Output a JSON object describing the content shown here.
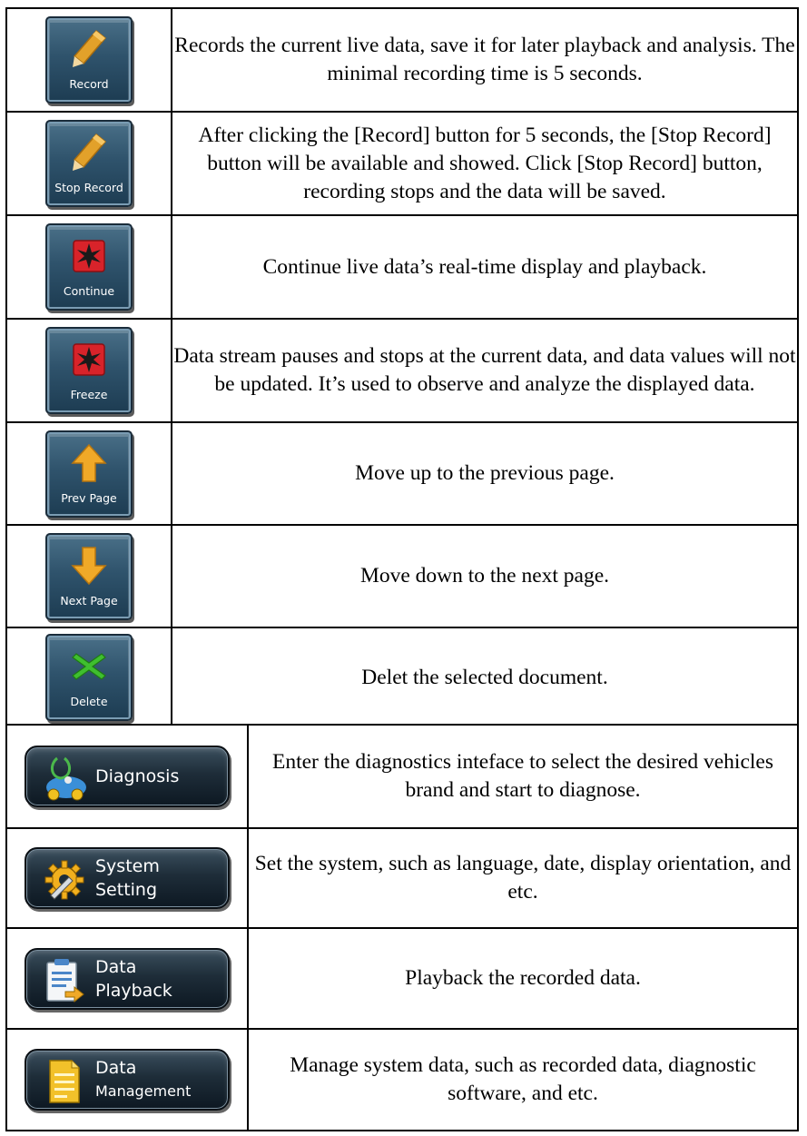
{
  "rows_small": [
    {
      "button_label": "Record",
      "icon": "pencil-icon",
      "description": "Records the current live data, save it for later playback and analysis. The minimal recording time is 5 seconds."
    },
    {
      "button_label": "Stop Record",
      "icon": "pencil-icon",
      "description": "After clicking the [Record] button for 5 seconds, the [Stop Record] button will be available and showed. Click [Stop Record] button, recording stops and the data will be saved."
    },
    {
      "button_label": "Continue",
      "icon": "red-star-icon",
      "description": "Continue live data’s real-time display and playback."
    },
    {
      "button_label": "Freeze",
      "icon": "red-star-icon",
      "description": "Data stream pauses and stops at the current data, and data values will not be updated. It’s used to observe and analyze the displayed data."
    },
    {
      "button_label": "Prev Page",
      "icon": "arrow-up-icon",
      "description": "Move up to the previous page."
    },
    {
      "button_label": "Next Page",
      "icon": "arrow-down-icon",
      "description": "Move down to the next page."
    },
    {
      "button_label": "Delete",
      "icon": "green-x-icon",
      "description": "Delet the selected document."
    }
  ],
  "rows_wide": [
    {
      "button_label_line1": "Diagnosis",
      "button_label_line2": "",
      "icon": "stethoscope-car-icon",
      "description": "Enter the diagnostics inteface to select the desired vehicles brand and start to diagnose."
    },
    {
      "button_label_line1": "System",
      "button_label_line2": "Setting",
      "icon": "gear-wrench-icon",
      "description": "Set the system, such as language, date, display orientation, and etc."
    },
    {
      "button_label_line1": "Data",
      "button_label_line2": "Playback",
      "icon": "clipboard-arrow-icon",
      "description": "Playback the recorded data."
    },
    {
      "button_label_line1": "Data",
      "button_label_line2": "Management",
      "icon": "notepad-icon",
      "description": "Manage system data, such as recorded data, diagnostic software, and etc."
    }
  ],
  "colors": {
    "button_blue_top": "#4a7088",
    "button_blue_bottom": "#1d3c52",
    "button_dark_top": "#3b4f5e",
    "button_dark_bottom": "#0d1822",
    "pencil": "#e2a12a",
    "star_box": "#d8232a",
    "arrow": "#f0a928",
    "x_green": "#3fbf2f"
  }
}
